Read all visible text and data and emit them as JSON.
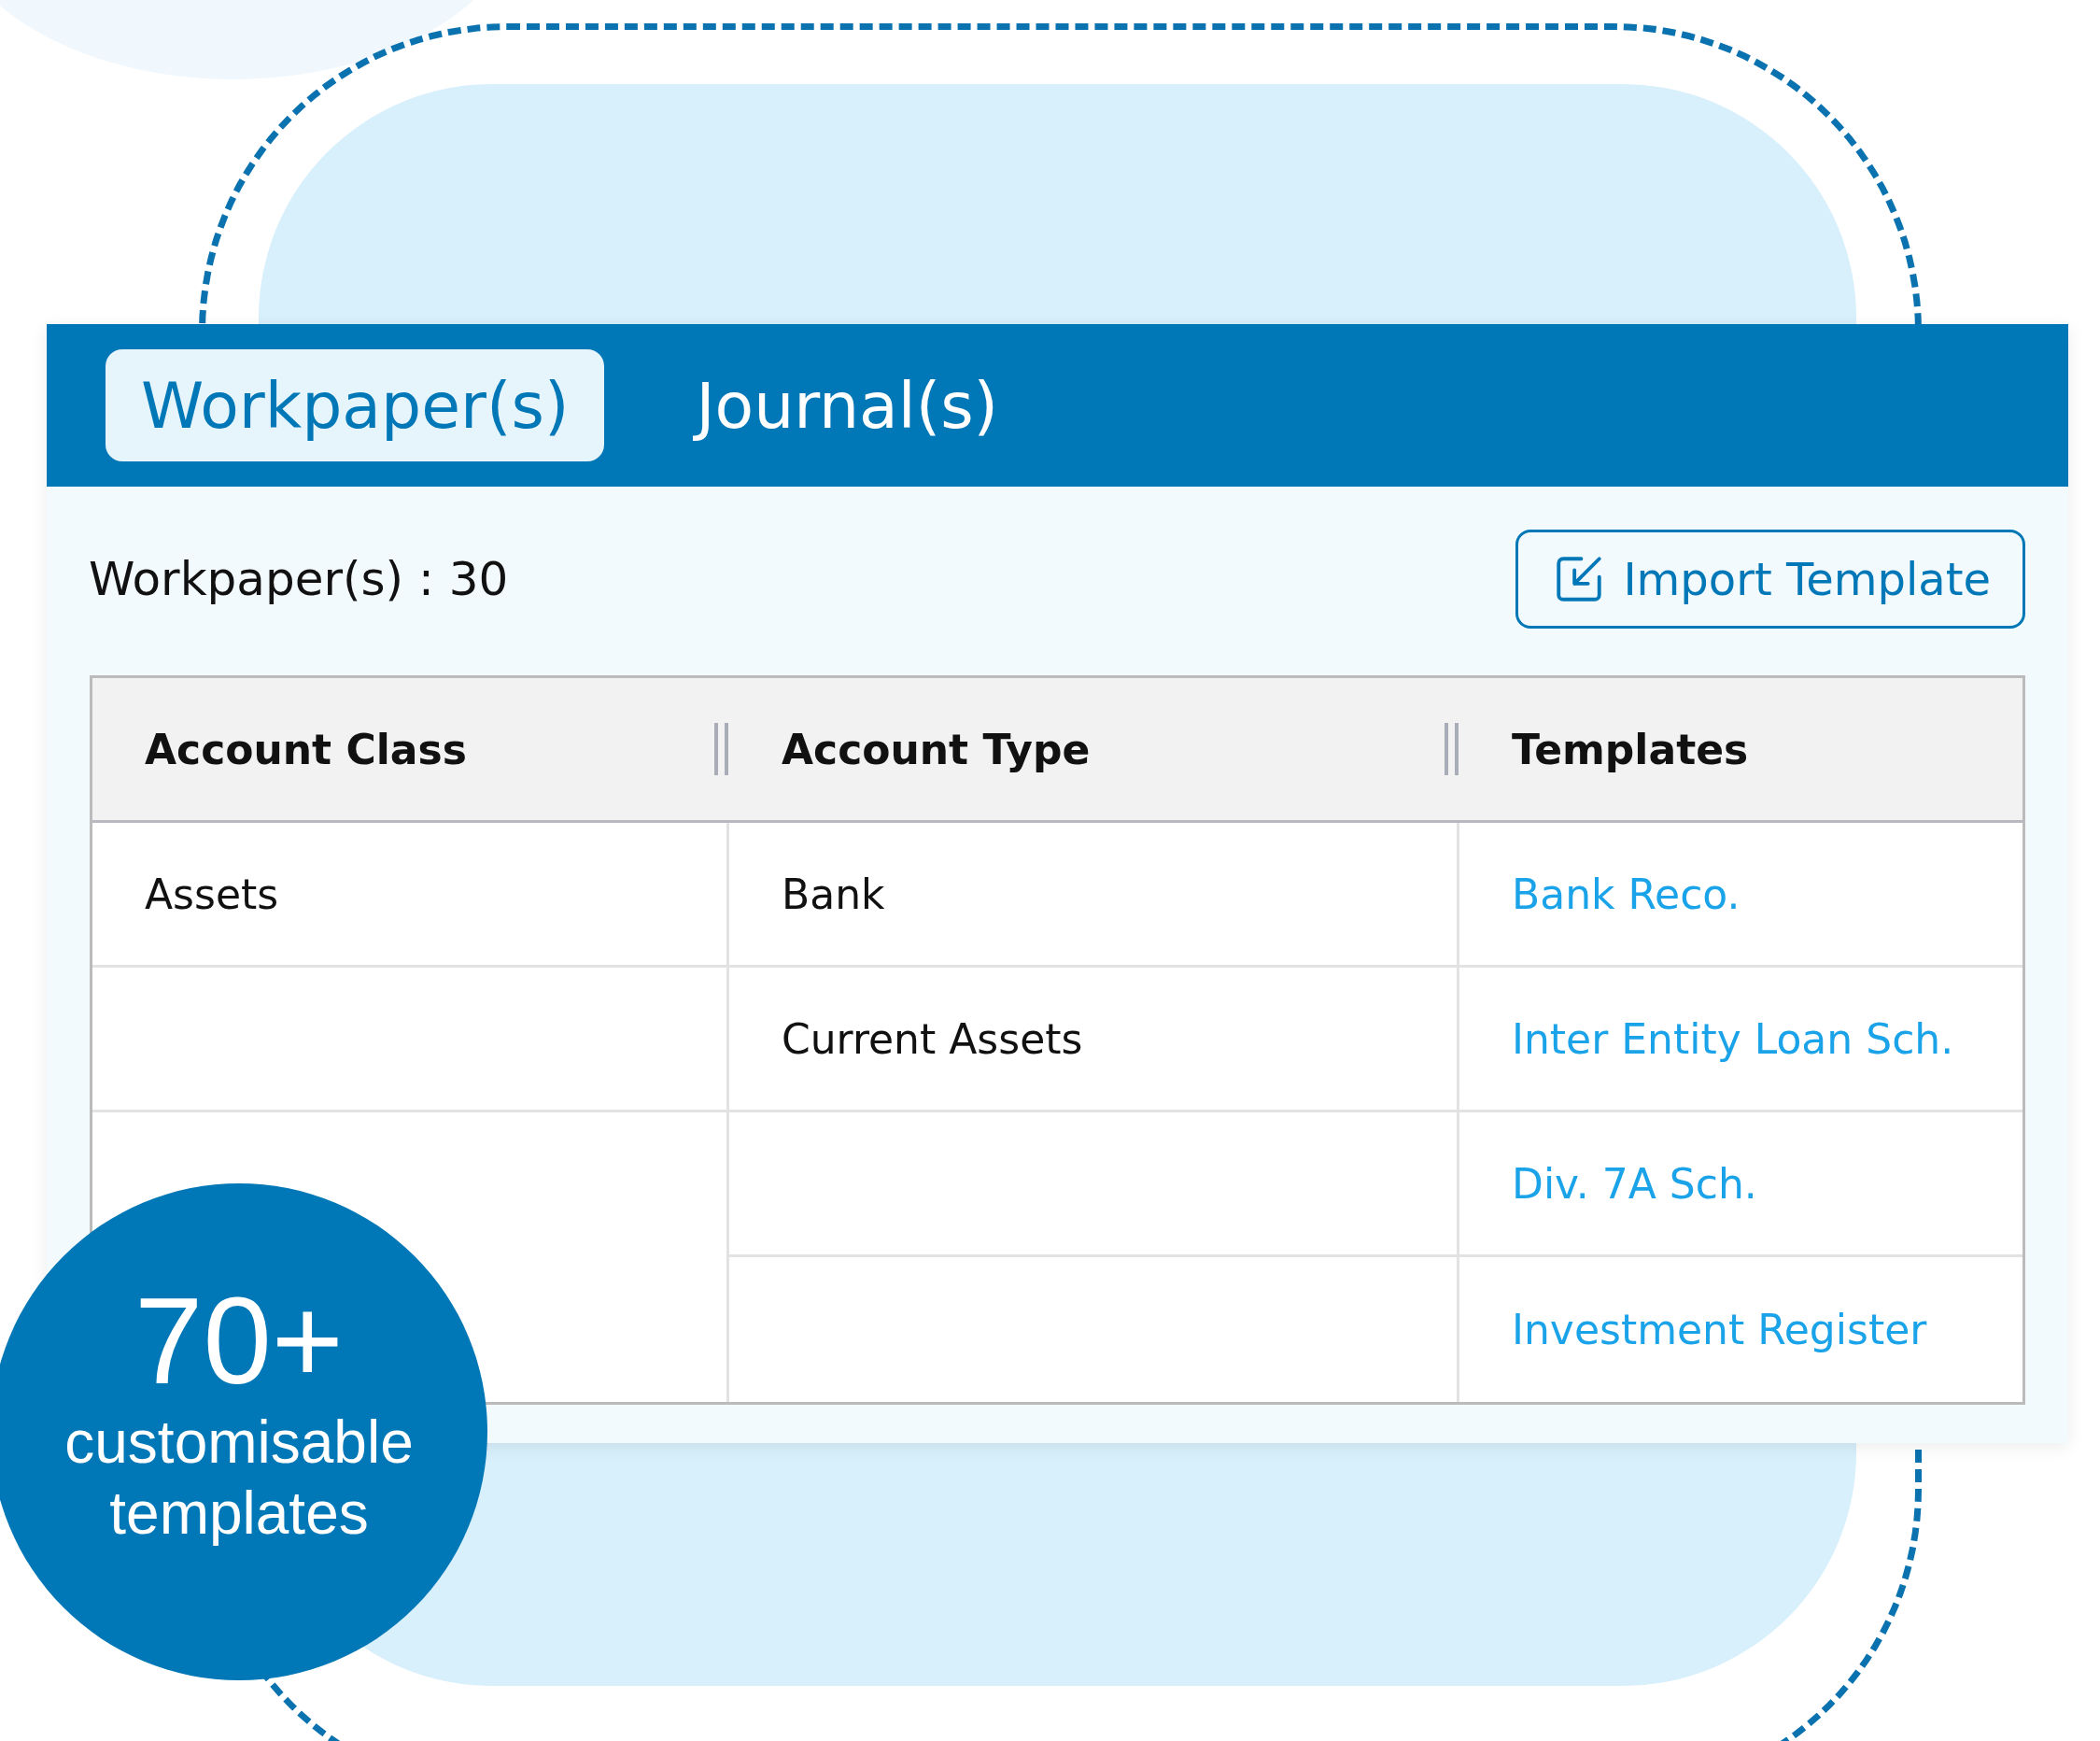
{
  "tabs": [
    {
      "label": "Workpaper(s)",
      "selected": true
    },
    {
      "label": "Journal(s)",
      "selected": false
    }
  ],
  "count_label": "Workpaper(s) : 30",
  "import_button": {
    "label": "Import Template"
  },
  "table": {
    "columns": [
      "Account Class",
      "Account Type",
      "Templates"
    ],
    "rows": [
      {
        "account_class": "Assets",
        "account_type": "Bank",
        "template": "Bank Reco."
      },
      {
        "account_type": "Current Assets",
        "template": "Inter Entity Loan Sch."
      },
      {
        "template": "Div. 7A Sch."
      },
      {
        "template": "Investment Register"
      }
    ]
  },
  "badge": {
    "number": "70+",
    "caption": "customisable templates"
  }
}
